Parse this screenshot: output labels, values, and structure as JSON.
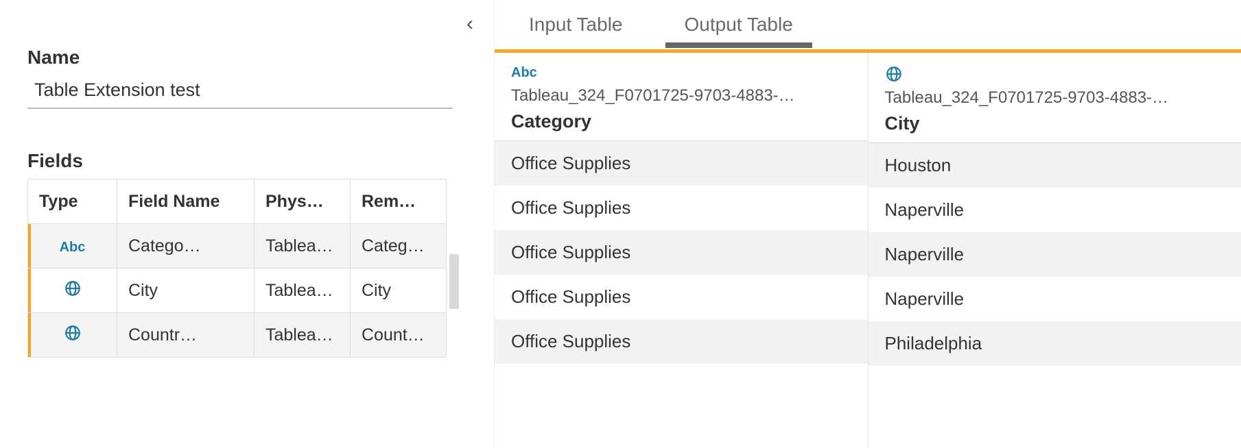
{
  "left": {
    "name_label": "Name",
    "name_value": "Table Extension test",
    "fields_label": "Fields",
    "columns": {
      "type": "Type",
      "field_name": "Field Name",
      "physical": "Phys…",
      "remote": "Rem…"
    },
    "rows": [
      {
        "type_icon": "abc",
        "type_text": "Abc",
        "field_name": "Catego…",
        "physical": "Tablea…",
        "remote": "Categ…"
      },
      {
        "type_icon": "globe",
        "type_text": "",
        "field_name": "City",
        "physical": "Tablea…",
        "remote": "City"
      },
      {
        "type_icon": "globe",
        "type_text": "",
        "field_name": "Countr…",
        "physical": "Tablea…",
        "remote": "Count…"
      }
    ]
  },
  "tabs": {
    "input": "Input Table",
    "output": "Output Table"
  },
  "output": {
    "columns": [
      {
        "type_icon": "abc",
        "type_text": "Abc",
        "source": "Tableau_324_F0701725-9703-4883-…",
        "name": "Category"
      },
      {
        "type_icon": "globe",
        "type_text": "",
        "source": "Tableau_324_F0701725-9703-4883-…",
        "name": "City"
      }
    ],
    "rows": [
      [
        "Office Supplies",
        "Houston"
      ],
      [
        "Office Supplies",
        "Naperville"
      ],
      [
        "Office Supplies",
        "Naperville"
      ],
      [
        "Office Supplies",
        "Naperville"
      ],
      [
        "Office Supplies",
        "Philadelphia"
      ]
    ]
  }
}
